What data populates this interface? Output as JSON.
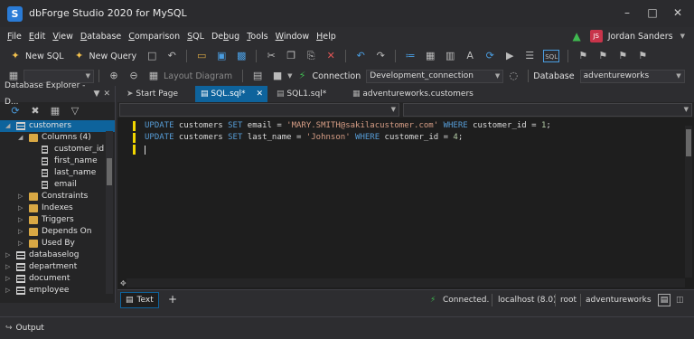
{
  "window": {
    "title": "dbForge Studio 2020 for MySQL",
    "icon_letter": "S"
  },
  "menu": [
    "File",
    "Edit",
    "View",
    "Database",
    "Comparison",
    "SQL",
    "Debug",
    "Tools",
    "Window",
    "Help"
  ],
  "menu_underline": [
    "F",
    "E",
    "V",
    "D",
    "C",
    "S",
    "b",
    "T",
    "W",
    "H"
  ],
  "user": {
    "initials": "JS",
    "name": "Jordan Sanders"
  },
  "toolbar1": {
    "new_sql": "New SQL",
    "new_query": "New Query"
  },
  "toolbar2": {
    "layout_diagram": "Layout Diagram",
    "connection_label": "Connection",
    "connection_value": "Development_connection",
    "database_label": "Database",
    "database_value": "adventureworks"
  },
  "explorer": {
    "title": "Database Explorer - D...",
    "items": [
      {
        "label": "customers",
        "level": 0,
        "type": "table",
        "expanded": true,
        "selected": true
      },
      {
        "label": "Columns (4)",
        "level": 1,
        "type": "folder",
        "expanded": true
      },
      {
        "label": "customer_id",
        "level": 2,
        "type": "column"
      },
      {
        "label": "first_name",
        "level": 2,
        "type": "column"
      },
      {
        "label": "last_name",
        "level": 2,
        "type": "column"
      },
      {
        "label": "email",
        "level": 2,
        "type": "column"
      },
      {
        "label": "Constraints",
        "level": 1,
        "type": "folder"
      },
      {
        "label": "Indexes",
        "level": 1,
        "type": "folder"
      },
      {
        "label": "Triggers",
        "level": 1,
        "type": "folder"
      },
      {
        "label": "Depends On",
        "level": 1,
        "type": "folder"
      },
      {
        "label": "Used By",
        "level": 1,
        "type": "folder"
      },
      {
        "label": "databaselog",
        "level": 0,
        "type": "table"
      },
      {
        "label": "department",
        "level": 0,
        "type": "table"
      },
      {
        "label": "document",
        "level": 0,
        "type": "table"
      },
      {
        "label": "employee",
        "level": 0,
        "type": "table"
      }
    ]
  },
  "tabs": [
    {
      "label": "Start Page",
      "active": false
    },
    {
      "label": "SQL.sql*",
      "active": true
    },
    {
      "label": "SQL1.sql*",
      "active": false
    },
    {
      "label": "adventureworks.customers",
      "active": false
    }
  ],
  "editor": {
    "line1": {
      "kw1": "UPDATE",
      "t1": " customers ",
      "kw2": "SET",
      "t2": " email = ",
      "str": "'MARY.SMITH@sakilacustomer.com'",
      "t3": " ",
      "kw3": "WHERE",
      "t4": " customer_id = ",
      "num": "1",
      "t5": ";"
    },
    "line2": {
      "kw1": "UPDATE",
      "t1": " customers ",
      "kw2": "SET",
      "t2": " last_name = ",
      "str": "'Johnson'",
      "t3": " ",
      "kw3": "WHERE",
      "t4": " customer_id = ",
      "num": "4",
      "t5": ";"
    }
  },
  "status": {
    "text_tab": "Text",
    "connected": "Connected.",
    "host": "localhost (8.0)",
    "user": "root",
    "database": "adventureworks"
  },
  "output": {
    "label": "Output"
  }
}
